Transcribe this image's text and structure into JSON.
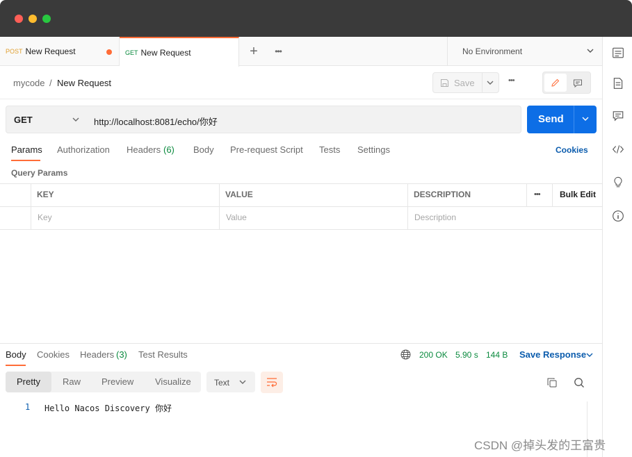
{
  "tabs": [
    {
      "method": "POST",
      "label": "New Request",
      "unsaved": true
    },
    {
      "method": "GET",
      "label": "New Request",
      "active": true
    }
  ],
  "environment": "No Environment",
  "breadcrumb": {
    "collection": "mycode",
    "separator": "/",
    "request": "New Request"
  },
  "save_label": "Save",
  "request": {
    "method": "GET",
    "url": "http://localhost:8081/echo/你好",
    "send_label": "Send"
  },
  "request_tabs": [
    {
      "label": "Params",
      "active": true
    },
    {
      "label": "Authorization"
    },
    {
      "label": "Headers",
      "count": "(6)"
    },
    {
      "label": "Body"
    },
    {
      "label": "Pre-request Script"
    },
    {
      "label": "Tests"
    },
    {
      "label": "Settings"
    }
  ],
  "cookies_label": "Cookies",
  "query_params_title": "Query Params",
  "table": {
    "headers": [
      "KEY",
      "VALUE",
      "DESCRIPTION"
    ],
    "bulk_edit": "Bulk Edit",
    "placeholders": [
      "Key",
      "Value",
      "Description"
    ]
  },
  "response_tabs": [
    {
      "label": "Body",
      "active": true
    },
    {
      "label": "Cookies"
    },
    {
      "label": "Headers",
      "count": "(3)"
    },
    {
      "label": "Test Results"
    }
  ],
  "response_status": {
    "status": "200 OK",
    "time": "5.90 s",
    "size": "144 B"
  },
  "save_response_label": "Save Response",
  "format_tabs": [
    "Pretty",
    "Raw",
    "Preview",
    "Visualize"
  ],
  "format_select": "Text",
  "response_body": {
    "line_number": "1",
    "text": "Hello Nacos Discovery 你好"
  },
  "watermark": "CSDN @掉头发的王富贵",
  "colors": {
    "accent": "#ff6c37",
    "send": "#0d6ee6",
    "status": "#0a8a3e",
    "link": "#0b5cad"
  }
}
